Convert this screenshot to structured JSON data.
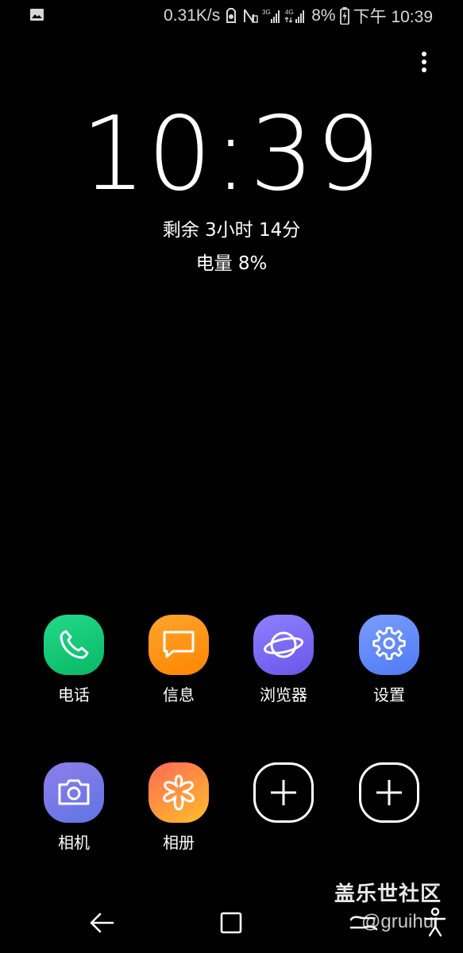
{
  "status_bar": {
    "network_speed": "0.31K/s",
    "network_1": "3G",
    "network_2": "4G",
    "battery_percent": "8%",
    "time": "下午 10:39",
    "icons": [
      "image-icon",
      "alarm-icon",
      "nfc-icon",
      "signal-3g-icon",
      "signal-4g-icon",
      "battery-charging-icon"
    ]
  },
  "menu_icon": "more-vert-icon",
  "clock": {
    "time": "10:39"
  },
  "battery": {
    "remaining_text": "剩余 3小时 14分",
    "level_text": "电量 8%"
  },
  "apps": [
    {
      "label": "电话",
      "icon": "phone-icon"
    },
    {
      "label": "信息",
      "icon": "message-icon"
    },
    {
      "label": "浏览器",
      "icon": "browser-icon"
    },
    {
      "label": "设置",
      "icon": "gear-icon"
    },
    {
      "label": "相机",
      "icon": "camera-icon"
    },
    {
      "label": "相册",
      "icon": "gallery-icon"
    },
    {
      "label": "",
      "icon": "add-icon"
    },
    {
      "label": "",
      "icon": "add-icon"
    }
  ],
  "watermark": {
    "title": "盖乐世社区",
    "subtitle": "@gruihui"
  },
  "navbar": {
    "icons": [
      "back-icon",
      "home-icon",
      "recents-icon",
      "accessibility-icon"
    ]
  },
  "colors": {
    "background": "#000000",
    "phone": "#12c978",
    "message": "#ff9310",
    "browser": "#7b6bf5",
    "settings": "#628bf7",
    "camera": "#7779e7",
    "gallery": "#ff8a3d"
  }
}
